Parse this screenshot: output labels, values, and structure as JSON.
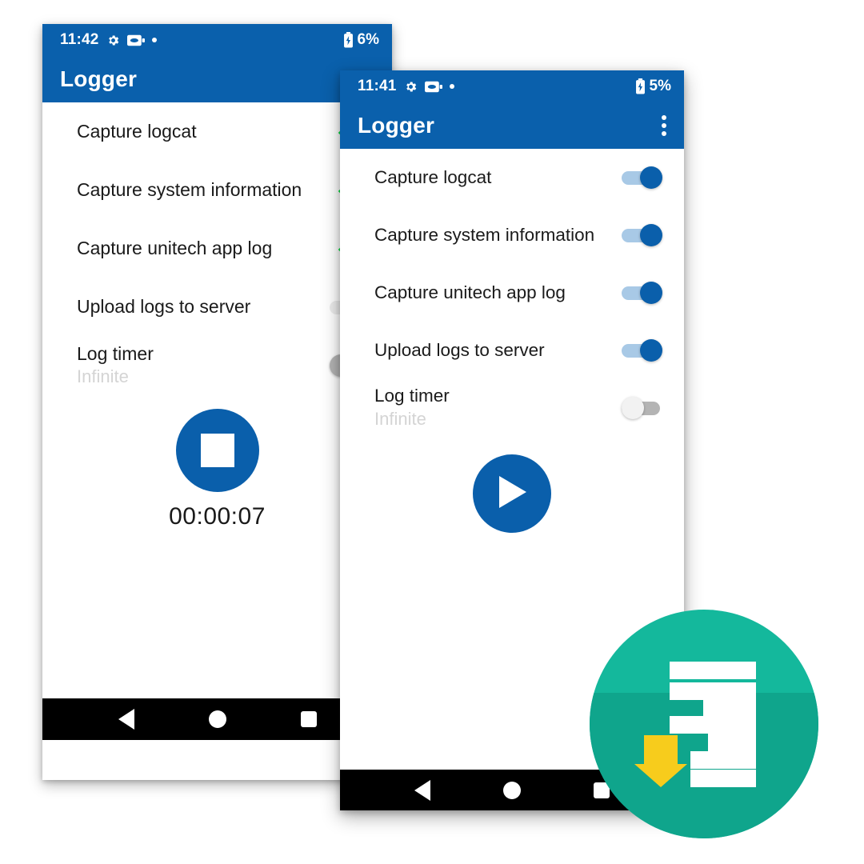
{
  "screenshot": {
    "title": "Unitech Logger app - two phone screens",
    "background": "#ffffff"
  },
  "colors": {
    "app_bar_blue": "#0a60ac",
    "accent_blue": "#0a5fab",
    "toggle_on_track": "#a8c9e6",
    "toggle_off_track": "#b4b4b4",
    "checkmark_green": "#00e03c",
    "icon_teal": "#0fa58c",
    "icon_teal_light": "#14b89c",
    "icon_yellow": "#f7cc1c",
    "nav_bar_black": "#000000",
    "subtitle_gray": "#d4d4d4"
  },
  "phone_back": {
    "status_bar": {
      "time": "11:42",
      "icons": [
        "gear-icon",
        "battery-saver-icon",
        "dot-icon"
      ],
      "battery_icon": "battery-charging-icon",
      "battery_percent": "6%"
    },
    "app_bar": {
      "title": "Logger"
    },
    "rows": [
      {
        "title": "Capture logcat",
        "subtitle": "",
        "control": "checkmark",
        "state": "checked"
      },
      {
        "title": "Capture system information",
        "subtitle": "",
        "control": "checkmark",
        "state": "checked"
      },
      {
        "title": "Capture unitech app log",
        "subtitle": "",
        "control": "checkmark",
        "state": "checked"
      },
      {
        "title": "Upload logs to server",
        "subtitle": "",
        "control": "toggle",
        "state": "gray-on"
      },
      {
        "title": "Log timer",
        "subtitle": "Infinite",
        "control": "toggle",
        "state": "gray-off"
      }
    ],
    "action": {
      "icon": "stop-icon",
      "label": "stop-recording-button",
      "timer": "00:00:07"
    },
    "nav_bar": {
      "back": "back-triangle-icon",
      "home": "home-circle-icon",
      "recents": "recents-square-icon"
    }
  },
  "phone_front": {
    "status_bar": {
      "time": "11:41",
      "icons": [
        "gear-icon",
        "battery-saver-icon",
        "dot-icon"
      ],
      "battery_icon": "battery-charging-icon",
      "battery_percent": "5%"
    },
    "app_bar": {
      "title": "Logger",
      "overflow": "overflow-menu-icon"
    },
    "rows": [
      {
        "title": "Capture logcat",
        "subtitle": "",
        "control": "toggle",
        "state": "on"
      },
      {
        "title": "Capture system information",
        "subtitle": "",
        "control": "toggle",
        "state": "on"
      },
      {
        "title": "Capture unitech app log",
        "subtitle": "",
        "control": "toggle",
        "state": "on"
      },
      {
        "title": "Upload logs to server",
        "subtitle": "",
        "control": "toggle",
        "state": "on"
      },
      {
        "title": "Log timer",
        "subtitle": "Infinite",
        "control": "toggle",
        "state": "off"
      }
    ],
    "action": {
      "icon": "play-icon",
      "label": "start-recording-button"
    },
    "nav_bar": {
      "back": "back-triangle-icon",
      "home": "home-circle-icon",
      "recents": "recents-square-icon"
    }
  },
  "app_icon": {
    "name": "logger-app-icon",
    "shape": "circle",
    "elements": [
      "document-lines",
      "download-arrow"
    ]
  }
}
